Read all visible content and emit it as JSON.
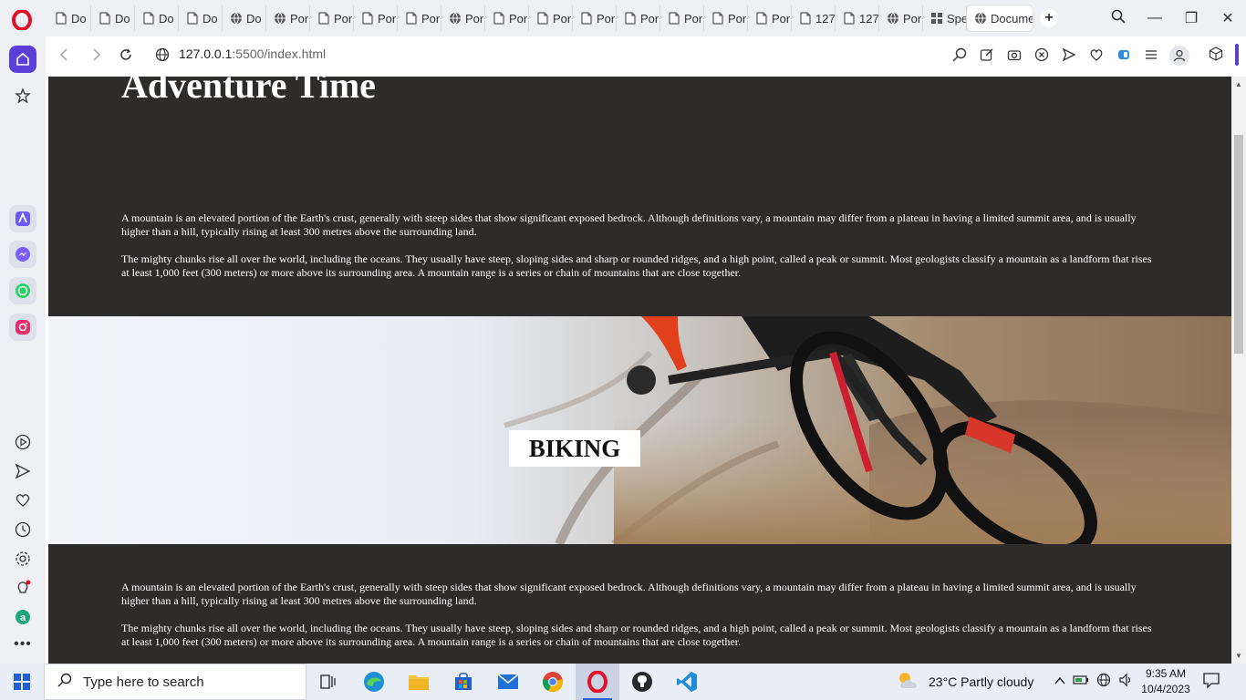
{
  "browser": {
    "tabs": [
      {
        "label": "Do",
        "type": "doc",
        "grouped": false
      },
      {
        "label": "Do",
        "type": "doc",
        "grouped": false
      },
      {
        "label": "Do",
        "type": "doc",
        "grouped": false
      },
      {
        "label": "Do",
        "type": "doc",
        "grouped": true
      },
      {
        "label": "Do",
        "type": "globe",
        "grouped": true
      },
      {
        "label": "Por",
        "type": "globe",
        "grouped": true
      },
      {
        "label": "Por",
        "type": "doc",
        "grouped": true
      },
      {
        "label": "Por",
        "type": "doc",
        "grouped": true
      },
      {
        "label": "Por",
        "type": "doc",
        "grouped": true
      },
      {
        "label": "Por",
        "type": "globe",
        "grouped": false
      },
      {
        "label": "Por",
        "type": "doc",
        "grouped": true
      },
      {
        "label": "Por",
        "type": "doc",
        "grouped": true
      },
      {
        "label": "Por",
        "type": "doc",
        "grouped": true
      },
      {
        "label": "Por",
        "type": "doc",
        "grouped": true
      },
      {
        "label": "Por",
        "type": "doc",
        "grouped": true
      },
      {
        "label": "Por",
        "type": "doc",
        "grouped": true
      },
      {
        "label": "Por",
        "type": "doc",
        "grouped": true
      },
      {
        "label": "127",
        "type": "doc",
        "grouped": true
      },
      {
        "label": "127",
        "type": "doc",
        "grouped": true
      },
      {
        "label": "Por",
        "type": "globe",
        "grouped": true
      },
      {
        "label": "Spe",
        "type": "grid",
        "grouped": false
      },
      {
        "label": "Docume",
        "type": "globe",
        "grouped": false,
        "active": true
      }
    ],
    "url_host": "127.0.0.1",
    "url_path": ":5500/index.html"
  },
  "page": {
    "title": "Adventure Time",
    "para1": "A mountain is an elevated portion of the Earth's crust, generally with steep sides that show significant exposed bedrock. Although definitions vary, a mountain may differ from a plateau in having a limited summit area, and is usually higher than a hill, typically rising at least 300 metres above the surrounding land.",
    "para2": "The mighty chunks rise all over the world, including the oceans. They usually have steep, sloping sides and sharp or rounded ridges, and a high point, called a peak or summit. Most geologists classify a mountain as a landform that rises at least 1,000 feet (300 meters) or more above its surrounding area. A mountain range is a series or chain of mountains that are close together.",
    "hero_label": "BIKING",
    "para3": "A mountain is an elevated portion of the Earth's crust, generally with steep sides that show significant exposed bedrock. Although definitions vary, a mountain may differ from a plateau in having a limited summit area, and is usually higher than a hill, typically rising at least 300 metres above the surrounding land.",
    "para4": "The mighty chunks rise all over the world, including the oceans. They usually have steep, sloping sides and sharp or rounded ridges, and a high point, called a peak or summit. Most geologists classify a mountain as a landform that rises at least 1,000 feet (300 meters) or more above its surrounding area. A mountain range is a series or chain of mountains that are close together."
  },
  "taskbar": {
    "search_placeholder": "Type here to search",
    "weather": "23°C  Partly cloudy",
    "time": "9:35 AM",
    "date": "10/4/2023"
  },
  "colors": {
    "page_bg": "#2e2b2b",
    "accent": "#5b3fd6",
    "opera_red": "#e0112b"
  }
}
